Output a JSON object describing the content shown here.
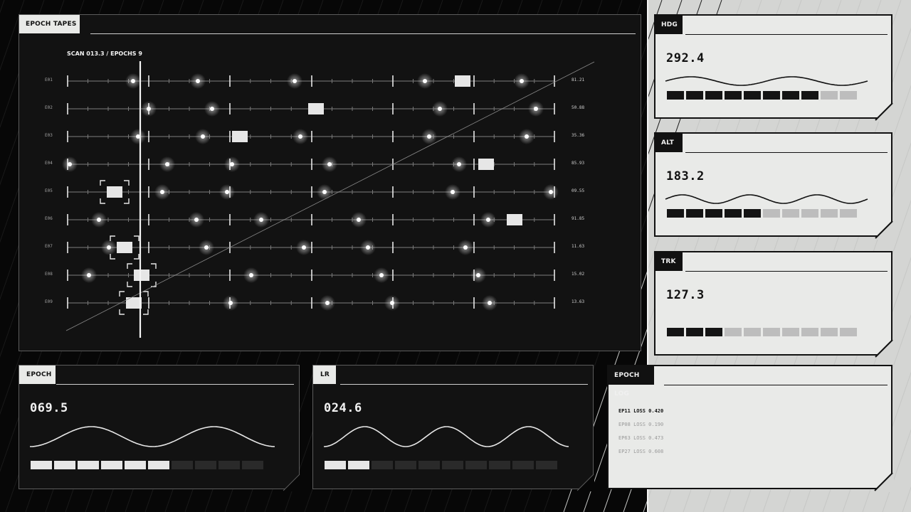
{
  "tapes": {
    "title": "EPOCH TAPES",
    "scan_label": "SCAN 013.3 / EPOCHS 9",
    "rows": [
      {
        "id": "E01",
        "value": "81.21"
      },
      {
        "id": "E02",
        "value": "50.88"
      },
      {
        "id": "E03",
        "value": "35.36"
      },
      {
        "id": "E04",
        "value": "85.93"
      },
      {
        "id": "E05",
        "value": "09.55"
      },
      {
        "id": "E06",
        "value": "91.85"
      },
      {
        "id": "E07",
        "value": "11.63"
      },
      {
        "id": "E08",
        "value": "15.02"
      },
      {
        "id": "E09",
        "value": "13.63"
      }
    ]
  },
  "gauges": [
    {
      "key": "hdg",
      "title": "HDG",
      "value": "292.4",
      "filled": 8,
      "total": 10
    },
    {
      "key": "alt",
      "title": "ALT",
      "value": "183.2",
      "filled": 5,
      "total": 10
    },
    {
      "key": "trk",
      "title": "TRK",
      "value": "127.3",
      "filled": 3,
      "total": 10
    }
  ],
  "epoch": {
    "title": "EPOCH",
    "value": "069.5",
    "filled": 6,
    "total": 10
  },
  "lr": {
    "title": "LR",
    "value": "024.6",
    "filled": 2,
    "total": 10
  },
  "log": {
    "title": "EPOCH LOG",
    "entries": [
      "EP11 LOSS 0.420",
      "EP08 LOSS 0.190",
      "EP63 LOSS 0.473",
      "EP27 LOSS 0.608"
    ]
  },
  "colors": {
    "bar_on_dark": "#e6e6e6",
    "bar_off_dark": "#2a2a2a",
    "bar_on_light": "#141414",
    "bar_off_light": "#bdbdbd"
  }
}
